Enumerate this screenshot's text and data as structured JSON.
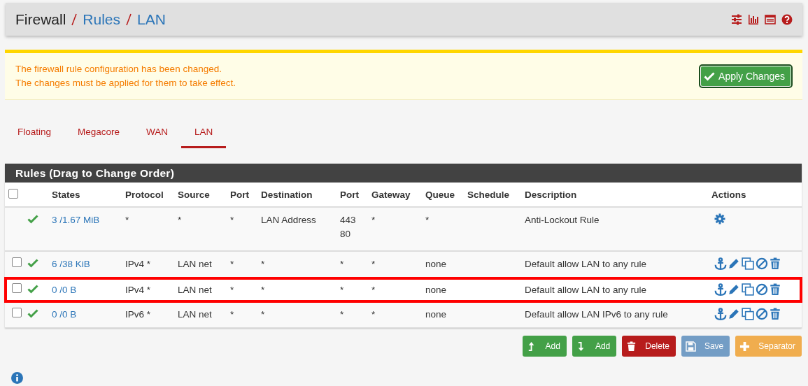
{
  "breadcrumb": [
    {
      "label": "Firewall",
      "kind": "plain"
    },
    {
      "label": "Rules",
      "kind": "link"
    },
    {
      "label": "LAN",
      "kind": "link"
    }
  ],
  "alert": {
    "lines": [
      "The firewall rule configuration has been changed.",
      "The changes must be applied for them to take effect."
    ],
    "button": "Apply Changes"
  },
  "tabs": [
    {
      "label": "Floating",
      "selected": false
    },
    {
      "label": "Megacore",
      "selected": false
    },
    {
      "label": "WAN",
      "selected": false
    },
    {
      "label": "LAN",
      "selected": true
    }
  ],
  "panel": {
    "title": "Rules (Drag to Change Order)",
    "select_all": {
      "checked": false
    },
    "columns": [
      "States",
      "Protocol",
      "Source",
      "Port",
      "Destination",
      "Port",
      "Gateway",
      "Queue",
      "Schedule",
      "Description",
      "Actions"
    ],
    "rows": [
      {
        "kind": "locked",
        "highlighted": false,
        "cells": [
          "3 /1.67 MiB",
          "*",
          "*",
          "*",
          "LAN Address",
          "443\n80",
          "*",
          "*",
          "",
          "Anti-Lockout Rule"
        ]
      },
      {
        "kind": "rule",
        "checked": false,
        "highlighted": false,
        "cells": [
          "6 /38 KiB",
          "IPv4 *",
          "LAN net",
          "*",
          "*",
          "*",
          "*",
          "none",
          "",
          "Default allow LAN to any rule"
        ]
      },
      {
        "kind": "rule",
        "checked": false,
        "highlighted": true,
        "cells": [
          "0 /0 B",
          "IPv4 *",
          "LAN net",
          "*",
          "*",
          "*",
          "*",
          "none",
          "",
          "Default allow LAN to any rule"
        ]
      },
      {
        "kind": "rule",
        "checked": false,
        "highlighted": false,
        "cells": [
          "0 /0 B",
          "IPv6 *",
          "LAN net",
          "*",
          "*",
          "*",
          "*",
          "none",
          "",
          "Default allow LAN IPv6 to any rule"
        ]
      }
    ]
  },
  "buttons": [
    {
      "label": "Add",
      "kind": "add-top",
      "disabled": false
    },
    {
      "label": "Add",
      "kind": "add-bottom",
      "disabled": false
    },
    {
      "label": "Delete",
      "kind": "delete",
      "disabled": false
    },
    {
      "label": "Save",
      "kind": "save",
      "disabled": true
    },
    {
      "label": "Separator",
      "kind": "separator",
      "disabled": false
    }
  ]
}
